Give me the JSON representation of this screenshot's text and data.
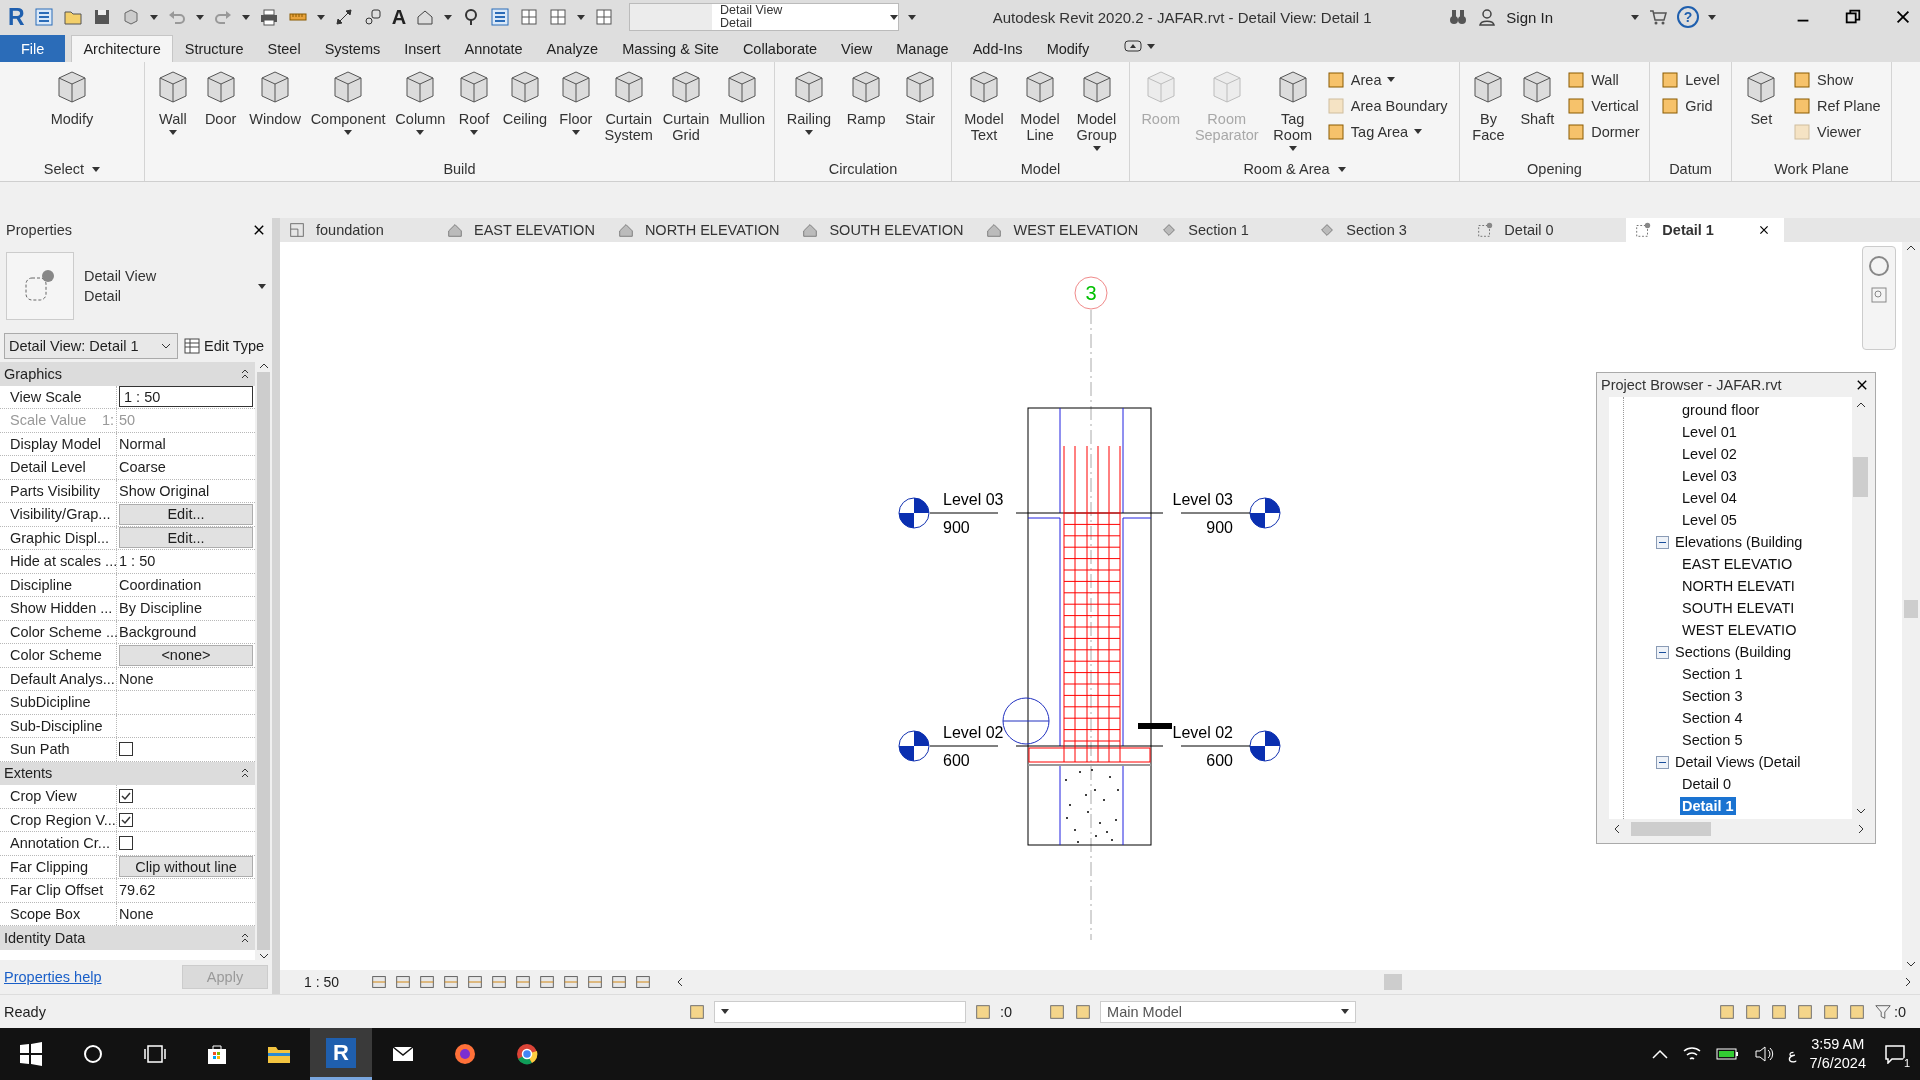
{
  "title_bar": {
    "logo": "R",
    "text_tool": "A",
    "view_selector": {
      "line_1": "Detail View",
      "line_2": "Detail"
    },
    "title": "Autodesk Revit 2020.2 - JAFAR.rvt - Detail View: Detail 1",
    "sign_in": "Sign In",
    "help": "?"
  },
  "ribbon_tabs": [
    {
      "label": "File",
      "kind": "file",
      "selected": false
    },
    {
      "label": "Architecture",
      "kind": "tab",
      "selected": true
    },
    {
      "label": "Structure",
      "kind": "tab",
      "selected": false
    },
    {
      "label": "Steel",
      "kind": "tab",
      "selected": false
    },
    {
      "label": "Systems",
      "kind": "tab",
      "selected": false
    },
    {
      "label": "Insert",
      "kind": "tab",
      "selected": false
    },
    {
      "label": "Annotate",
      "kind": "tab",
      "selected": false
    },
    {
      "label": "Analyze",
      "kind": "tab",
      "selected": false
    },
    {
      "label": "Massing & Site",
      "kind": "tab",
      "selected": false
    },
    {
      "label": "Collaborate",
      "kind": "tab",
      "selected": false
    },
    {
      "label": "View",
      "kind": "tab",
      "selected": false
    },
    {
      "label": "Manage",
      "kind": "tab",
      "selected": false
    },
    {
      "label": "Add-Ins",
      "kind": "tab",
      "selected": false
    },
    {
      "label": "Modify",
      "kind": "tab",
      "selected": false
    }
  ],
  "ribbon_panels": [
    {
      "title": "Select",
      "menu": true,
      "tools": [
        {
          "kind": "large",
          "label": "Modify",
          "menu": false,
          "disabled": false
        }
      ]
    },
    {
      "title": "Build",
      "menu": false,
      "tools": [
        {
          "kind": "large",
          "label": "Wall",
          "menu": true,
          "disabled": false
        },
        {
          "kind": "large",
          "label": "Door",
          "menu": false,
          "disabled": false
        },
        {
          "kind": "large",
          "label": "Window",
          "menu": false,
          "disabled": false
        },
        {
          "kind": "large",
          "label": "Component",
          "menu": true,
          "disabled": false
        },
        {
          "kind": "large",
          "label": "Column",
          "menu": true,
          "disabled": false
        },
        {
          "kind": "large",
          "label": "Roof",
          "menu": true,
          "disabled": false
        },
        {
          "kind": "large",
          "label": "Ceiling",
          "menu": false,
          "disabled": false
        },
        {
          "kind": "large",
          "label": "Floor",
          "menu": true,
          "disabled": false
        },
        {
          "kind": "large",
          "label": "Curtain System",
          "menu": false,
          "disabled": false
        },
        {
          "kind": "large",
          "label": "Curtain Grid",
          "menu": false,
          "disabled": false
        },
        {
          "kind": "large",
          "label": "Mullion",
          "menu": false,
          "disabled": false
        }
      ]
    },
    {
      "title": "Circulation",
      "menu": false,
      "tools": [
        {
          "kind": "large",
          "label": "Railing",
          "menu": true,
          "disabled": false
        },
        {
          "kind": "large",
          "label": "Ramp",
          "menu": false,
          "disabled": false
        },
        {
          "kind": "large",
          "label": "Stair",
          "menu": false,
          "disabled": false
        }
      ]
    },
    {
      "title": "Model",
      "menu": false,
      "tools": [
        {
          "kind": "large",
          "label": "Model Text",
          "menu": false,
          "disabled": false
        },
        {
          "kind": "large",
          "label": "Model Line",
          "menu": false,
          "disabled": false
        },
        {
          "kind": "large",
          "label": "Model Group",
          "menu": true,
          "disabled": false
        }
      ]
    },
    {
      "title": "Room & Area",
      "menu": true,
      "tools": [
        {
          "kind": "large",
          "label": "Room",
          "menu": false,
          "disabled": true
        },
        {
          "kind": "large",
          "label": "Room Separator",
          "menu": false,
          "disabled": true
        },
        {
          "kind": "large",
          "label": "Tag Room",
          "menu": true,
          "disabled": false
        },
        {
          "kind": "small",
          "label": "Area",
          "menu": true,
          "disabled": false
        },
        {
          "kind": "small",
          "label": "Area Boundary",
          "menu": false,
          "disabled": true
        },
        {
          "kind": "small",
          "label": "Tag Area",
          "menu": true,
          "disabled": false
        }
      ]
    },
    {
      "title": "Opening",
      "menu": false,
      "tools": [
        {
          "kind": "large",
          "label": "By Face",
          "menu": false,
          "disabled": false
        },
        {
          "kind": "large",
          "label": "Shaft",
          "menu": false,
          "disabled": false
        },
        {
          "kind": "small",
          "label": "Wall",
          "menu": false,
          "disabled": false
        },
        {
          "kind": "small",
          "label": "Vertical",
          "menu": false,
          "disabled": false
        },
        {
          "kind": "small",
          "label": "Dormer",
          "menu": false,
          "disabled": false
        }
      ]
    },
    {
      "title": "Datum",
      "menu": false,
      "tools": [
        {
          "kind": "small",
          "label": "Level",
          "menu": false,
          "disabled": false
        },
        {
          "kind": "small",
          "label": "Grid",
          "menu": false,
          "disabled": false
        }
      ]
    },
    {
      "title": "Work Plane",
      "menu": false,
      "tools": [
        {
          "kind": "large",
          "label": "Set",
          "menu": false,
          "disabled": false
        },
        {
          "kind": "small",
          "label": "Show",
          "menu": false,
          "disabled": false
        },
        {
          "kind": "small",
          "label": "Ref Plane",
          "menu": false,
          "disabled": false
        },
        {
          "kind": "small",
          "label": "Viewer",
          "menu": false,
          "disabled": true
        }
      ]
    }
  ],
  "properties": {
    "title": "Properties",
    "type_family": "Detail View",
    "type_name": "Detail",
    "instance": "Detail View: Detail 1",
    "edit_type": "Edit Type",
    "groups": [
      {
        "title": "Graphics",
        "rows": [
          {
            "label": "View Scale",
            "kind": "input",
            "value": "1 : 50",
            "disabled": false
          },
          {
            "label": "Scale Value",
            "kind": "text",
            "prefix": "1:",
            "value": "50",
            "disabled": true
          },
          {
            "label": "Display Model",
            "kind": "text",
            "value": "Normal",
            "disabled": false
          },
          {
            "label": "Detail Level",
            "kind": "text",
            "value": "Coarse",
            "disabled": false
          },
          {
            "label": "Parts Visibility",
            "kind": "text",
            "value": "Show Original",
            "disabled": false
          },
          {
            "label": "Visibility/Grap...",
            "kind": "button",
            "value": "Edit...",
            "disabled": false
          },
          {
            "label": "Graphic Displ...",
            "kind": "button",
            "value": "Edit...",
            "disabled": false
          },
          {
            "label": "Hide at scales ...",
            "kind": "text",
            "value": "1 : 50",
            "disabled": false
          },
          {
            "label": "Discipline",
            "kind": "text",
            "value": "Coordination",
            "disabled": false
          },
          {
            "label": "Show Hidden ...",
            "kind": "text",
            "value": "By Discipline",
            "disabled": false
          },
          {
            "label": "Color Scheme ...",
            "kind": "text",
            "value": "Background",
            "disabled": false
          },
          {
            "label": "Color Scheme",
            "kind": "button",
            "value": "<none>",
            "disabled": false
          },
          {
            "label": "Default Analys...",
            "kind": "text",
            "value": "None",
            "disabled": false
          },
          {
            "label": "SubDicipline",
            "kind": "text",
            "disabled": false
          },
          {
            "label": "Sub-Discipline",
            "kind": "text",
            "disabled": false
          },
          {
            "label": "Sun Path",
            "kind": "checkbox",
            "checked": false,
            "disabled": false
          }
        ]
      },
      {
        "title": "Extents",
        "rows": [
          {
            "label": "Crop View",
            "kind": "checkbox",
            "checked": true,
            "disabled": false
          },
          {
            "label": "Crop Region V...",
            "kind": "checkbox",
            "checked": true,
            "disabled": false
          },
          {
            "label": "Annotation Cr...",
            "kind": "checkbox",
            "checked": false,
            "disabled": false
          },
          {
            "label": "Far Clipping",
            "kind": "button",
            "value": "Clip without line",
            "disabled": false
          },
          {
            "label": "Far Clip Offset",
            "kind": "text",
            "value": "79.62",
            "disabled": false
          },
          {
            "label": "Scope Box",
            "kind": "text",
            "value": "None",
            "disabled": false
          }
        ]
      },
      {
        "title": "Identity Data"
      }
    ],
    "help_link": "Properties help",
    "apply": {
      "label": "Apply",
      "disabled": true
    }
  },
  "view_tabs": [
    {
      "label": "foundation",
      "kind": "plan",
      "selected": false
    },
    {
      "label": "EAST ELEVATION",
      "kind": "elevation",
      "selected": false
    },
    {
      "label": "NORTH ELEVATION",
      "kind": "elevation",
      "selected": false
    },
    {
      "label": "SOUTH ELEVATION",
      "kind": "elevation",
      "selected": false
    },
    {
      "label": "WEST ELEVATION",
      "kind": "elevation",
      "selected": false
    },
    {
      "label": "Section 1",
      "kind": "section",
      "selected": false
    },
    {
      "label": "Section 3",
      "kind": "section",
      "selected": false
    },
    {
      "label": "Detail 0",
      "kind": "detail",
      "selected": false
    },
    {
      "label": "Detail 1",
      "kind": "detail",
      "selected": true
    }
  ],
  "drawing": {
    "grid_label": "3",
    "levels": [
      {
        "name": "Level 03",
        "elevation": "900"
      },
      {
        "name": "Level 03",
        "elevation": "900"
      },
      {
        "name": "Level 02",
        "elevation": "600"
      },
      {
        "name": "Level 02",
        "elevation": "600"
      }
    ]
  },
  "project_browser": {
    "title": "Project Browser - JAFAR.rvt",
    "tree": [
      {
        "children": [
          {
            "label": "ground floor",
            "selected": false
          },
          {
            "label": "Level 01",
            "selected": false
          },
          {
            "label": "Level 02",
            "selected": false
          },
          {
            "label": "Level 03",
            "selected": false
          },
          {
            "label": "Level 04",
            "selected": false
          },
          {
            "label": "Level 05",
            "selected": false
          }
        ]
      },
      {
        "label": "Elevations (Building",
        "expanded": true,
        "children": [
          {
            "label": "EAST ELEVATIO",
            "selected": false
          },
          {
            "label": "NORTH ELEVATI",
            "selected": false
          },
          {
            "label": "SOUTH ELEVATI",
            "selected": false
          },
          {
            "label": "WEST ELEVATIO",
            "selected": false
          }
        ]
      },
      {
        "label": "Sections (Building",
        "expanded": true,
        "children": [
          {
            "label": "Section 1",
            "selected": false
          },
          {
            "label": "Section 3",
            "selected": false
          },
          {
            "label": "Section 4",
            "selected": false
          },
          {
            "label": "Section 5",
            "selected": false
          }
        ]
      },
      {
        "label": "Detail Views (Detail",
        "expanded": true,
        "children": [
          {
            "label": "Detail 0",
            "selected": false
          },
          {
            "label": "Detail 1",
            "selected": true
          }
        ]
      }
    ]
  },
  "view_bar": {
    "scale": "1 : 50"
  },
  "status_bar": {
    "status": "Ready",
    "pick_count": ":0",
    "workset": "Main Model",
    "filter_count": ":0"
  },
  "taskbar": {
    "app_letter": "R",
    "language": "ع",
    "time": "3:59 AM",
    "date": "7/6/2024",
    "notifications": "1"
  }
}
